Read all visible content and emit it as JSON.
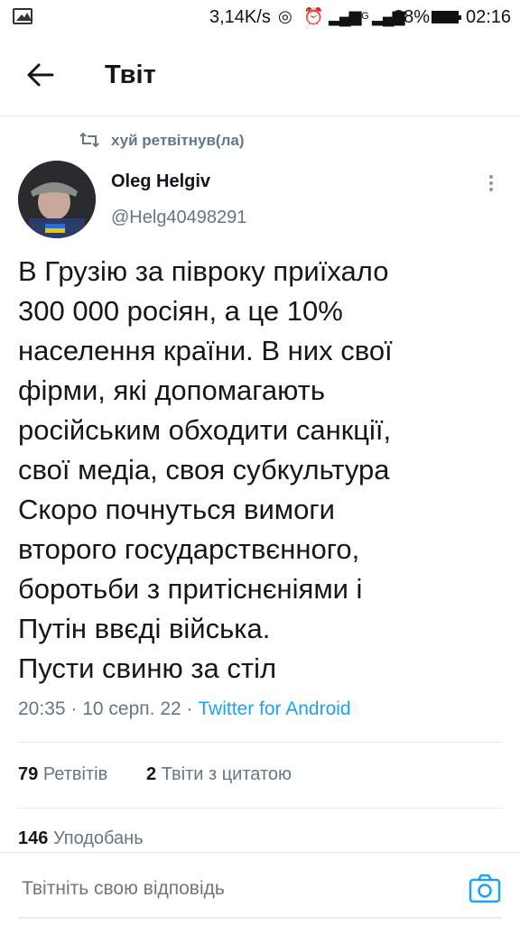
{
  "status_bar": {
    "speed": "3,14K/s",
    "network": "4G",
    "battery": "88%",
    "time": "02:16"
  },
  "header": {
    "title": "Твіт"
  },
  "retweet": {
    "label": "хуй ретвітнув(ла)"
  },
  "author": {
    "name": "Oleg Helgiv",
    "handle": "@Helg40498291"
  },
  "tweet": {
    "lines": [
      "В Грузію за півроку приїхало",
      "300 000 росіян, а це 10%",
      "населення країни. В них свої",
      "фірми, які допомагають",
      "російським обходити санкції,",
      "свої медіа, своя субкультура",
      "Скоро почнуться вимоги",
      "второго государствєнного,",
      "боротьби з притіснєніями і",
      "Путін ввєді війська.",
      "Пусти свиню за стіл"
    ],
    "time": "20:35",
    "date": "10 серп. 22",
    "source": "Twitter for Android"
  },
  "stats": {
    "retweets_count": "79",
    "retweets_label": "Ретвітів",
    "quotes_count": "2",
    "quotes_label": "Твіти з цитатою",
    "likes_count": "146",
    "likes_label": "Уподобань"
  },
  "reply": {
    "placeholder": "Твітніть свою відповідь"
  },
  "colors": {
    "link": "#1da1f2",
    "secondary": "#657786",
    "text": "#14171a"
  }
}
